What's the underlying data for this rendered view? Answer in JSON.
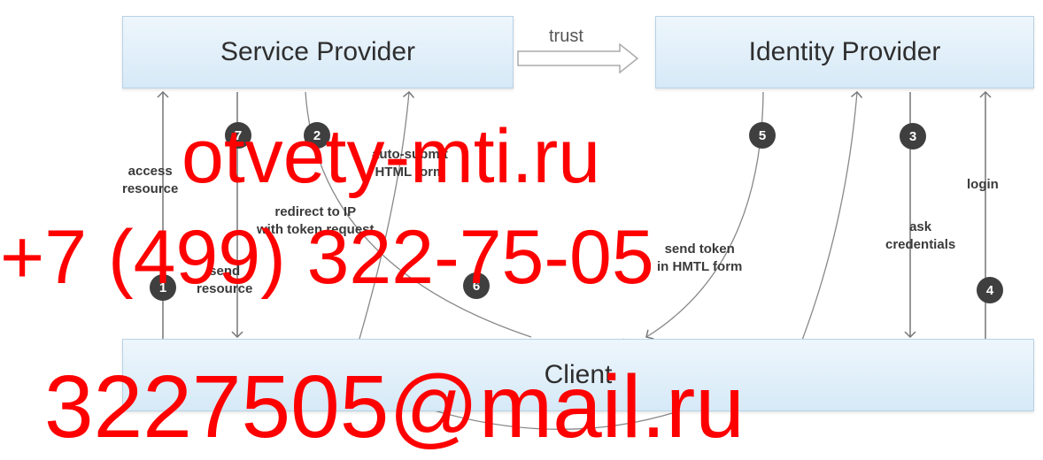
{
  "diagram": {
    "nodes": {
      "service_provider": "Service Provider",
      "identity_provider": "Identity Provider",
      "client": "Client"
    },
    "trust_label": "trust",
    "edges": {
      "access_resource": "access\nresource",
      "send_resource": "send\nresource",
      "redirect_to_ip": "redirect to IP\nwith token request",
      "auto_submit": "auto-submit\nHTML form",
      "send_token": "send token\nin HMTL form",
      "ask_credentials": "ask\ncredentials",
      "login": "login"
    },
    "steps": [
      "1",
      "2",
      "3",
      "4",
      "5",
      "6",
      "7"
    ]
  },
  "watermark": {
    "site": "otvety-mti.ru",
    "phone": "+7 (499) 322-75-05",
    "email": "3227505@mail.ru"
  }
}
